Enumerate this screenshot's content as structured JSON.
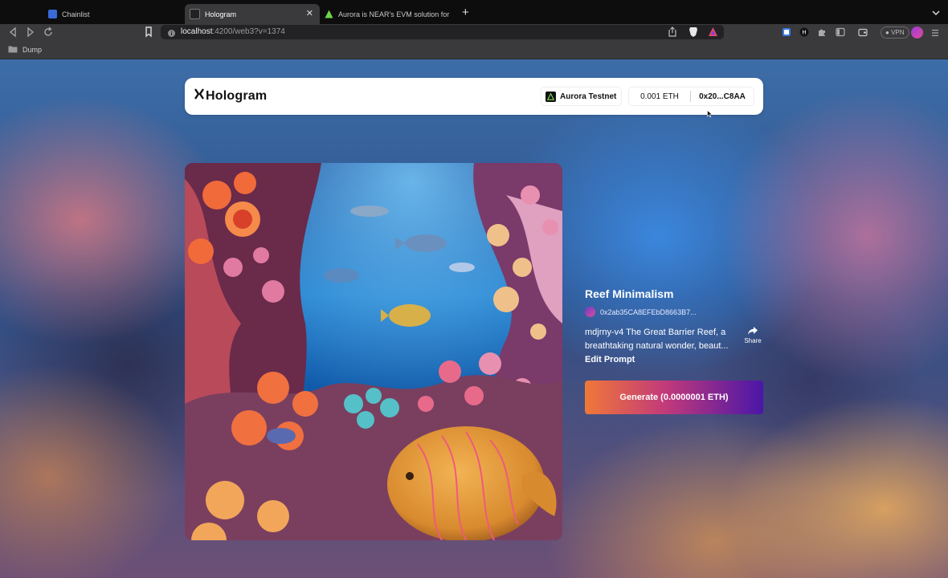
{
  "browser": {
    "tabs": [
      {
        "title": "Chainlist",
        "active": false
      },
      {
        "title": "Hologram",
        "active": true
      },
      {
        "title": "Aurora is NEAR's EVM solution for ...",
        "active": false
      }
    ],
    "url_host": "localhost",
    "url_rest": ":4200/web3?v=1374",
    "vpn_label": "VPN",
    "bookmark_folder": "Dump"
  },
  "header": {
    "logo_text": "Hologram",
    "network": "Aurora Testnet",
    "balance": "0.001 ETH",
    "address": "0x20...C8AA"
  },
  "artwork": {
    "title": "Reef Minimalism",
    "owner": "0x2ab35CA8EFEbD8663B7...",
    "description": "mdjrny-v4 The Great Barrier Reef, a breathtaking natural wonder, beaut...",
    "edit_label": "Edit Prompt",
    "share_label": "Share",
    "generate_label": "Generate (0.0000001 ETH)"
  },
  "colors": {
    "accent_start": "#f07838",
    "accent_end": "#4a16a8"
  }
}
